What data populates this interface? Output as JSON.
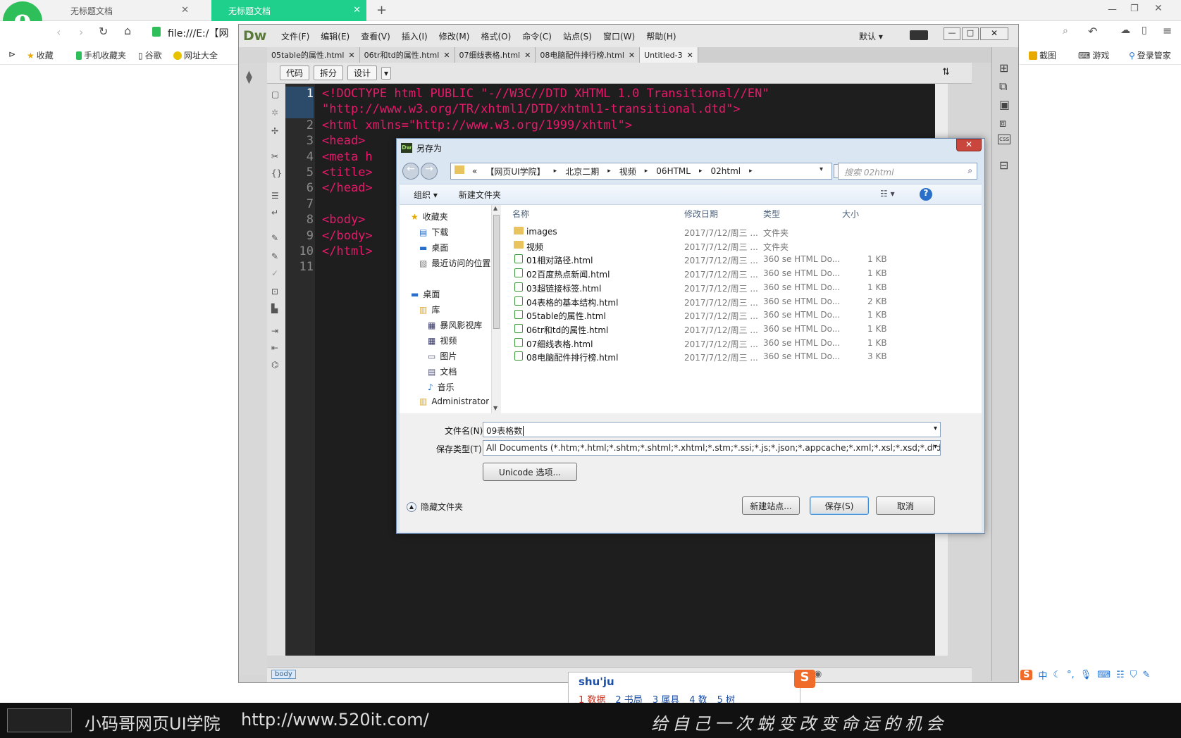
{
  "browser": {
    "tabs": [
      {
        "label": "无标题文档"
      },
      {
        "label": "无标题文档"
      }
    ],
    "address": "file:///E:/【网",
    "favorites": [
      "收藏",
      "手机收藏夹",
      "谷歌",
      "网址大全"
    ],
    "right_favorites": [
      "截图",
      "游戏",
      "登录管家"
    ]
  },
  "dw": {
    "logo": "Dw",
    "menu": [
      "文件(F)",
      "编辑(E)",
      "查看(V)",
      "插入(I)",
      "修改(M)",
      "格式(O)",
      "命令(C)",
      "站点(S)",
      "窗口(W)",
      "帮助(H)"
    ],
    "workspace": "默认",
    "doc_tabs": [
      "05table的属性.html",
      "06tr和td的属性.html",
      "07细线表格.html",
      "08电脑配件排行榜.html",
      "Untitled-3"
    ],
    "view_buttons": [
      "代码",
      "拆分",
      "设计"
    ],
    "code_lines": [
      {
        "n": "1",
        "parts": [
          {
            "t": "<!DOCTYPE html PUBLIC \"-//W3C//DTD XHTML 1.0 Transitional//EN\"",
            "c": "tag"
          }
        ]
      },
      {
        "n": "",
        "parts": [
          {
            "t": "\"http://www.w3.org/TR/xhtml1/DTD/xhtml1-transitional.dtd\">",
            "c": "tag"
          }
        ]
      },
      {
        "n": "2",
        "parts": [
          {
            "t": "<html xmlns=\"http://www.w3.org/1999/xhtml\">",
            "c": "tag"
          }
        ]
      },
      {
        "n": "3",
        "parts": [
          {
            "t": "<head>",
            "c": "tag"
          }
        ]
      },
      {
        "n": "4",
        "parts": [
          {
            "t": "<meta h",
            "c": "tag"
          }
        ]
      },
      {
        "n": "5",
        "parts": [
          {
            "t": "<title>",
            "c": "tag"
          }
        ]
      },
      {
        "n": "6",
        "parts": [
          {
            "t": "</head>",
            "c": "tag"
          }
        ]
      },
      {
        "n": "7",
        "parts": []
      },
      {
        "n": "8",
        "parts": [
          {
            "t": "<body>",
            "c": "tag"
          }
        ]
      },
      {
        "n": "9",
        "parts": [
          {
            "t": "</body>",
            "c": "tag"
          }
        ]
      },
      {
        "n": "10",
        "parts": [
          {
            "t": "</html>",
            "c": "tag"
          }
        ]
      },
      {
        "n": "11",
        "parts": []
      }
    ],
    "status_tag": "body"
  },
  "dialog": {
    "title": "另存为",
    "path": [
      "«",
      "【网页UI学院】",
      "北京二期",
      "视频",
      "06HTML",
      "02html"
    ],
    "search_placeholder": "搜索 02html",
    "organize": "组织 ▾",
    "new_folder": "新建文件夹",
    "nav": {
      "favorites": "收藏夹",
      "favorites_items": [
        "下载",
        "桌面",
        "最近访问的位置"
      ],
      "desktop": "桌面",
      "library": "库",
      "library_items": [
        "暴风影视库",
        "视频",
        "图片",
        "文档",
        "音乐"
      ],
      "admin": "Administrator"
    },
    "columns": {
      "name": "名称",
      "date": "修改日期",
      "type": "类型",
      "size": "大小"
    },
    "files": [
      {
        "name": "images",
        "date": "2017/7/12/周三 ...",
        "type": "文件夹",
        "size": "",
        "folder": true
      },
      {
        "name": "视频",
        "date": "2017/7/12/周三 ...",
        "type": "文件夹",
        "size": "",
        "folder": true
      },
      {
        "name": "01相对路径.html",
        "date": "2017/7/12/周三 ...",
        "type": "360 se HTML Do...",
        "size": "1 KB",
        "folder": false
      },
      {
        "name": "02百度热点新闻.html",
        "date": "2017/7/12/周三 ...",
        "type": "360 se HTML Do...",
        "size": "1 KB",
        "folder": false
      },
      {
        "name": "03超链接标签.html",
        "date": "2017/7/12/周三 ...",
        "type": "360 se HTML Do...",
        "size": "1 KB",
        "folder": false
      },
      {
        "name": "04表格的基本结构.html",
        "date": "2017/7/12/周三 ...",
        "type": "360 se HTML Do...",
        "size": "2 KB",
        "folder": false
      },
      {
        "name": "05table的属性.html",
        "date": "2017/7/12/周三 ...",
        "type": "360 se HTML Do...",
        "size": "1 KB",
        "folder": false
      },
      {
        "name": "06tr和td的属性.html",
        "date": "2017/7/12/周三 ...",
        "type": "360 se HTML Do...",
        "size": "1 KB",
        "folder": false
      },
      {
        "name": "07细线表格.html",
        "date": "2017/7/12/周三 ...",
        "type": "360 se HTML Do...",
        "size": "1 KB",
        "folder": false
      },
      {
        "name": "08电脑配件排行榜.html",
        "date": "2017/7/12/周三 ...",
        "type": "360 se HTML Do...",
        "size": "3 KB",
        "folder": false
      }
    ],
    "filename_label": "文件名(N):",
    "filename_value": "09表格数",
    "filetype_label": "保存类型(T):",
    "filetype_value": "All Documents (*.htm;*.html;*.shtm;*.shtml;*.xhtml;*.stm;*.ssi;*.js;*.json;*.appcache;*.xml;*.xsl;*.xsd;*.dtd;*.rss;*.rdf;*.lbi;*.",
    "unicode_button": "Unicode 选项...",
    "hide_folders": "隐藏文件夹",
    "new_site_button": "新建站点...",
    "save_button": "保存(S)",
    "cancel_button": "取消"
  },
  "ime": {
    "input": "shu'ju",
    "candidates": [
      "1 数据",
      "2 书局",
      "3 属具",
      "4 数",
      "5 树"
    ]
  },
  "footer": {
    "brand": "小码哥网页UI学院",
    "url": "http://www.520it.com/",
    "slogan": "给自己一次蜕变改变命运的机会"
  }
}
